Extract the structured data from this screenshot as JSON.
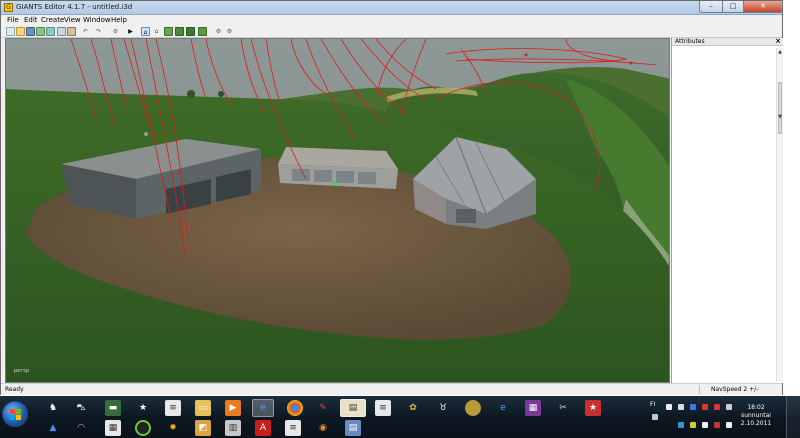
{
  "window": {
    "title": "GIANTS Editor 4.1.7 - untitled.i3d",
    "minimize": "–",
    "maximize": "□",
    "close": "✕"
  },
  "menu": [
    "File",
    "Edit",
    "Create",
    "View",
    "Window",
    "Help"
  ],
  "toolbar": {
    "icons": [
      "new-file-icon",
      "open-folder-icon",
      "save-icon",
      "import-icon",
      "export-icon",
      "copy-icon",
      "paste-icon",
      "undo-icon",
      "redo-icon",
      "play-icon",
      "select-tool-icon",
      "move-tool-icon",
      "terrain-icon",
      "paint-terrain-icon",
      "foliage-icon",
      "grass-icon",
      "settings-icon",
      "gear-icon"
    ]
  },
  "viewport": {
    "corner_label": "persp"
  },
  "attributes_panel": {
    "title": "Attributes",
    "close": "×"
  },
  "status": {
    "left": "Ready",
    "right": "NavSpeed 2 +/-"
  },
  "taskbar": {
    "pinned_icons": [
      "robot-icon",
      "car-icon",
      "tractor-icon",
      "star-icon",
      "document-icon",
      "folder-icon",
      "media-player-icon",
      "internet-explorer-icon",
      "chrome-icon",
      "paint-icon",
      "photo-viewer-icon",
      "notepad-icon",
      "palette-icon",
      "bull-icon",
      "coin-icon",
      "internet-explorer-icon-2",
      "winrar-icon",
      "tools-icon",
      "flag-icon"
    ],
    "bottom_row_icons": [
      "alien-icon",
      "headset-icon",
      "calculator-icon",
      "xbox-icon",
      "fireworks-icon",
      "archive-icon",
      "pdf-icon",
      "document-icon-2",
      "blender-icon",
      "editor-icon"
    ]
  },
  "tray": {
    "lang": "FI",
    "time": "18:02",
    "day": "sunnuntai",
    "date": "2.10.2011"
  },
  "colors": {
    "red_lines": "#e01a1a",
    "grass": "#3f6a28",
    "dirt": "#6d5a40",
    "sky": "#8f9a98"
  }
}
